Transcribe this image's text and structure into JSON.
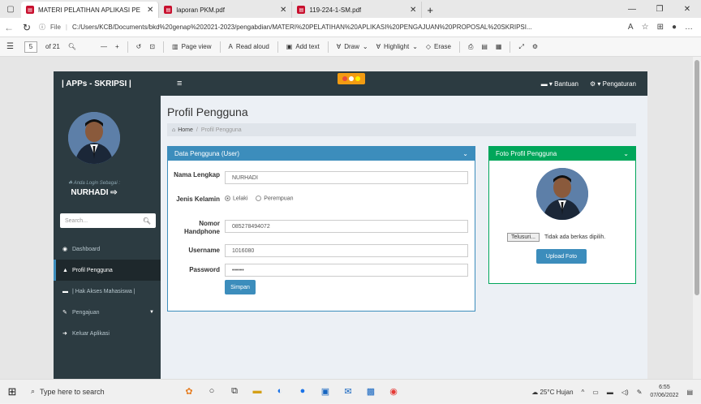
{
  "browser": {
    "tabs": [
      {
        "label": "MATERI PELATIHAN APLIKASI PE",
        "active": true
      },
      {
        "label": "laporan PKM.pdf",
        "active": false
      },
      {
        "label": "119-224-1-SM.pdf",
        "active": false
      }
    ],
    "url_scheme": "File",
    "url": "C:/Users/KCB/Documents/bkd%20genap%202021-2023/pengabdian/MATERI%20PELATIHAN%20APLIKASI%20PENGAJUAN%20PROPOSAL%20SKRIPSI..."
  },
  "pdf_toolbar": {
    "page_number": "5",
    "page_total": "of 21",
    "page_view": "Page view",
    "read_aloud": "Read aloud",
    "add_text": "Add text",
    "draw": "Draw",
    "highlight": "Highlight",
    "erase": "Erase"
  },
  "app": {
    "brand": "| APPs - SKRIPSI |",
    "top_help": "Bantuan",
    "top_settings": "Pengaturan",
    "sidebar": {
      "login_as": "Anda Login Sebagai :",
      "user_name": "NURHADI",
      "search_placeholder": "Search...",
      "items": [
        {
          "label": "Dashboard",
          "icon": "dashboard-icon"
        },
        {
          "label": "Profil Pengguna",
          "icon": "user-icon"
        },
        {
          "label": "| Hak Akses Mahasiswa |",
          "icon": "list-icon"
        },
        {
          "label": "Pengajuan",
          "icon": "edit-icon"
        },
        {
          "label": "Keluar Aplikasi",
          "icon": "signout-icon"
        }
      ]
    },
    "page_title": "Profil Pengguna",
    "breadcrumb": {
      "home": "Home",
      "current": "Profil Pengguna"
    },
    "user_box": {
      "title": "Data Pengguna (User)",
      "fields": {
        "name_label": "Nama Lengkap",
        "name_value": "NURHADI",
        "gender_label": "Jenis Kelamin",
        "gender_male": "Lelaki",
        "gender_female": "Perempuan",
        "phone_label": "Nomor Handphone",
        "phone_value": "085278494072",
        "username_label": "Username",
        "username_value": "1016080",
        "password_label": "Password",
        "password_value": "••••••"
      },
      "save_label": "Simpan"
    },
    "photo_box": {
      "title": "Foto Profil Pengguna",
      "browse_label": "Telusuri...",
      "no_file": "Tidak ada berkas dipilih.",
      "upload_label": "Upload Foto"
    },
    "colors": {
      "sidebar": "#2c3b41",
      "primary": "#3c8dbc",
      "success": "#00a65a"
    }
  },
  "taskbar": {
    "search_placeholder": "Type here to search",
    "weather": "25°C Hujan",
    "time": "6:55",
    "date": "07/06/2022"
  }
}
